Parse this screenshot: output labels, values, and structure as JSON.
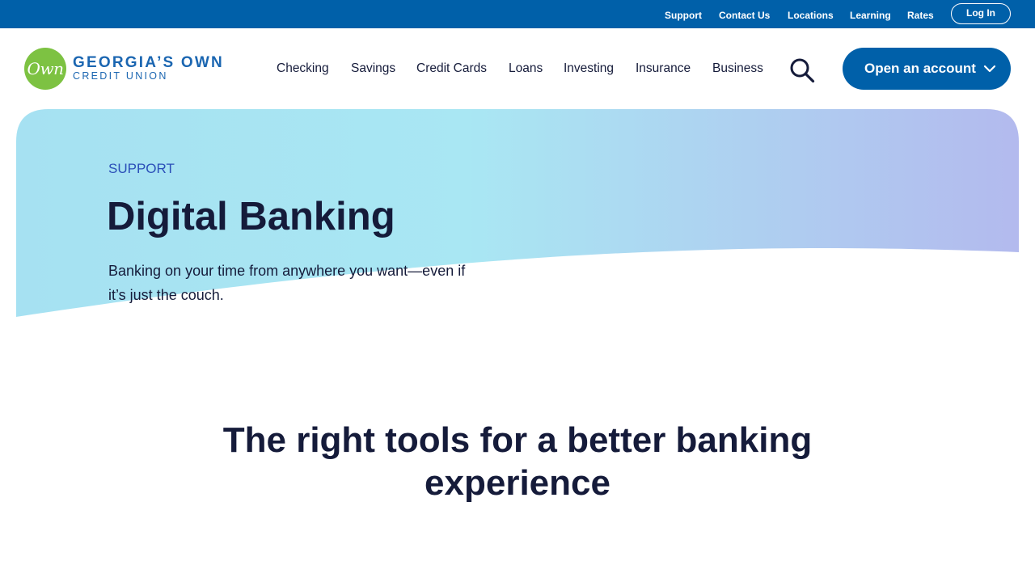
{
  "utility_nav": {
    "links": [
      "Support",
      "Contact Us",
      "Locations",
      "Learning",
      "Rates"
    ],
    "login_label": "Log In"
  },
  "brand": {
    "mark_text": "Own",
    "name_line1": "GEORGIA’S OWN",
    "name_line2": "CREDIT UNION"
  },
  "main_nav": {
    "items": [
      "Checking",
      "Savings",
      "Credit Cards",
      "Loans",
      "Investing",
      "Insurance",
      "Business"
    ],
    "search_icon": "search-icon",
    "cta_label": "Open an account",
    "cta_icon": "chevron-down-icon"
  },
  "hero": {
    "eyebrow": "SUPPORT",
    "title": "Digital Banking",
    "subtitle": "Banking on your time from anywhere you want—even if it’s just the couch."
  },
  "section": {
    "heading": "The right tools for a better banking experience"
  },
  "colors": {
    "utility_bar": "#0060a9",
    "primary_button": "#0060a9",
    "brand_green": "#7dc242",
    "brand_blue": "#1b66b1",
    "text_dark": "#151b3a",
    "eyebrow_blue": "#2b4fb8",
    "hero_gradient_start": "#a6e1f2",
    "hero_gradient_mid": "#a9e7f3",
    "hero_gradient_end": "#b3baee"
  }
}
